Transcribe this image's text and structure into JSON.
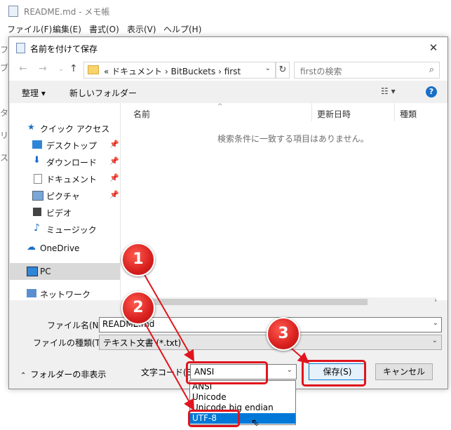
{
  "notepad": {
    "title": "README.md - メモ帳",
    "menu": [
      "ファイル(F)",
      "編集(E)",
      "書式(O)",
      "表示(V)",
      "ヘルプ(H)"
    ],
    "edge_chars": [
      "フ",
      "ブ",
      "タ",
      "リ",
      "ス"
    ]
  },
  "dialog": {
    "title": "名前を付けて保存",
    "close": "✕",
    "address": {
      "prefix": "«",
      "crumbs": [
        "ドキュメント",
        "BitBuckets",
        "first"
      ],
      "separator": "›"
    },
    "search_placeholder": "firstの検索",
    "toolbar": {
      "organize": "整理 ▾",
      "new_folder": "新しいフォルダー",
      "view": "☷ ▾",
      "help": "?"
    },
    "nav": {
      "quick_access": "クイック アクセス",
      "desktop": "デスクトップ",
      "downloads": "ダウンロード",
      "documents": "ドキュメント",
      "pictures": "ピクチャ",
      "videos": "ビデオ",
      "music": "ミュージック",
      "onedrive": "OneDrive",
      "pc": "PC",
      "network": "ネットワーク"
    },
    "columns": {
      "name": "名前",
      "modified": "更新日時",
      "type": "種類"
    },
    "empty_message": "検索条件に一致する項目はありません。",
    "filename_label": "ファイル名(N):",
    "filename_value": "README.md",
    "filetype_label": "ファイルの種類(T):",
    "filetype_value": "テキスト文書 (*.txt)",
    "hide_folders": "フォルダーの非表示",
    "encoding_label": "文字コード(E):",
    "encoding_value": "ANSI",
    "save_button": "保存(S)",
    "cancel_button": "キャンセル"
  },
  "encoding_options": [
    "ANSI",
    "Unicode",
    "Unicode big endian",
    "UTF-8"
  ],
  "encoding_selected_index": 3,
  "callouts": [
    "1",
    "2",
    "3"
  ],
  "colors": {
    "highlight": "#e0141e",
    "selection": "#0078d7",
    "help": "#1a6fc7"
  }
}
